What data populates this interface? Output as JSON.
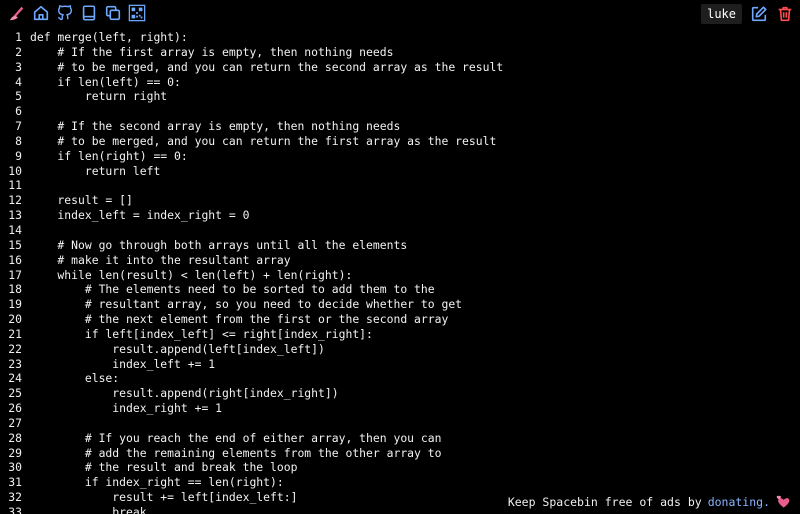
{
  "app": {
    "brand_color": "#e85d8a",
    "accent_blue": "#6ea8ff",
    "delete_red": "#ff4d4d"
  },
  "header": {
    "username": "luke",
    "icons": [
      "logo-icon",
      "home-icon",
      "github-icon",
      "book-icon",
      "copy-icon",
      "qr-icon"
    ],
    "actions": [
      "edit-icon",
      "delete-icon"
    ]
  },
  "code": {
    "lines": [
      "def merge(left, right):",
      "    # If the first array is empty, then nothing needs",
      "    # to be merged, and you can return the second array as the result",
      "    if len(left) == 0:",
      "        return right",
      "",
      "    # If the second array is empty, then nothing needs",
      "    # to be merged, and you can return the first array as the result",
      "    if len(right) == 0:",
      "        return left",
      "",
      "    result = []",
      "    index_left = index_right = 0",
      "",
      "    # Now go through both arrays until all the elements",
      "    # make it into the resultant array",
      "    while len(result) < len(left) + len(right):",
      "        # The elements need to be sorted to add them to the",
      "        # resultant array, so you need to decide whether to get",
      "        # the next element from the first or the second array",
      "        if left[index_left] <= right[index_right]:",
      "            result.append(left[index_left])",
      "            index_left += 1",
      "        else:",
      "            result.append(right[index_right])",
      "            index_right += 1",
      "",
      "        # If you reach the end of either array, then you can",
      "        # add the remaining elements from the other array to",
      "        # the result and break the loop",
      "        if index_right == len(right):",
      "            result += left[index_left:]",
      "            break"
    ]
  },
  "footer": {
    "text": "Keep Spacebin free of ads by",
    "link": "donating."
  }
}
